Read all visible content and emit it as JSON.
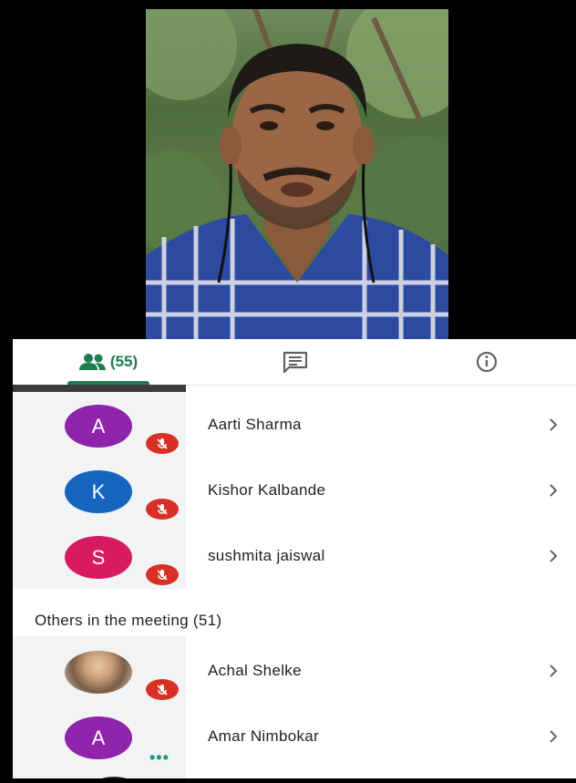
{
  "tabs": {
    "people_count": "(55)"
  },
  "participants_top": [
    {
      "initial": "A",
      "name": "Aarti Sharma",
      "avatar_color": "#8e24aa",
      "muted": true
    },
    {
      "initial": "K",
      "name": "Kishor Kalbande",
      "avatar_color": "#1565c0",
      "muted": true
    },
    {
      "initial": "S",
      "name": "sushmita jaiswal",
      "avatar_color": "#d81b60",
      "muted": true
    }
  ],
  "others_header": "Others in the meeting (51)",
  "participants_others": [
    {
      "initial": "",
      "name": "Achal Shelke",
      "avatar": "photo",
      "muted": true
    },
    {
      "initial": "A",
      "name": "Amar Nimbokar",
      "avatar_color": "#8e24aa",
      "muted": false,
      "status": "speaking-dots"
    }
  ],
  "colors": {
    "accent": "#1e7d4f",
    "mute_badge": "#d93025",
    "rail": "#f1f3f4"
  }
}
